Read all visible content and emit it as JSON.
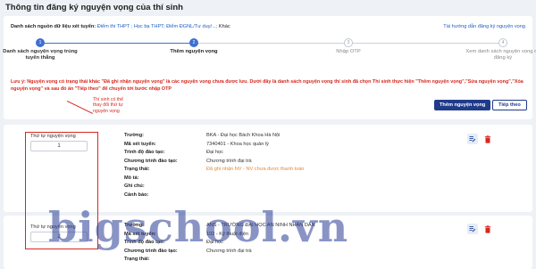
{
  "page": {
    "title": "Thông tin đăng ký nguyện vọng của thí sinh"
  },
  "sources": {
    "label": "Danh sách nguồn dữ liệu xét tuyển:",
    "value": "Điểm thi THPT ; Học bạ THPT; Điểm ĐGNL/Tư duy/...;",
    "tail": "Khác"
  },
  "guide_link": "Tài hướng dẫn đăng ký nguyện vọng",
  "steps": [
    {
      "number": "1",
      "label": "Danh sách nguyện vọng trúng tuyển thẳng",
      "state": "done"
    },
    {
      "number": "2",
      "label": "Thêm nguyện vọng",
      "state": "current"
    },
    {
      "number": "3",
      "label": "Nhập OTP",
      "state": "todo"
    },
    {
      "number": "4",
      "label": "Xem danh sách nguyện vọng đã đăng ký",
      "state": "todo"
    }
  ],
  "note": "Lưu ý: Nguyện vọng có trạng thái khác \"Đã ghi nhận nguyện vọng\" là các nguyện vọng chưa được lưu. Dưới đây là danh sách nguyện vọng thí sinh đã chọn Thí sinh thực hiện \"Thêm nguyện vọng\",\"Sửa nguyện vọng\",\"Xóa nguyện vọng\" và sau đó ấn \"Tiếp theo\" để chuyển tới bước nhập OTP",
  "buttons": {
    "add": "Thêm nguyện vọng",
    "next": "Tiếp theo"
  },
  "annotation": "Thí sinh có thể thay đổi thứ tự nguyện vọng",
  "field_labels": {
    "order": "Thứ tự nguyện vọng",
    "school": "Trường:",
    "major_code": "Mã xét tuyển:",
    "level": "Trình độ đào tạo:",
    "program": "Chương trình đào tạo:",
    "status": "Trạng thái:",
    "description": "Mô tả:",
    "notes": "Ghi chú:",
    "warning": "Cảnh báo:"
  },
  "wishes": [
    {
      "order": "1",
      "school": "BKA - Đại học Bách Khoa Hà Nội",
      "major_code": "7340401 - Khoa học quản lý",
      "level": "Đại học",
      "program": "Chương trình đại trà",
      "status": "Đã ghi nhận NV - NV chưa được thanh toán"
    },
    {
      "order": "2",
      "school": "ANS - TRƯỜNG ĐẠI HỌC AN NINH NHÂN DÂN",
      "major_code": "102 - Kỹ thuật điện",
      "level": "Đại học",
      "program": "Chương trình đại trà"
    }
  ],
  "watermark": "bigschool.vn",
  "colors": {
    "accent": "#1f3b8a",
    "warning": "#d6281e",
    "status": "#e08a3c"
  },
  "icons": {
    "edit": "edit-list-icon",
    "delete": "trash-icon"
  }
}
